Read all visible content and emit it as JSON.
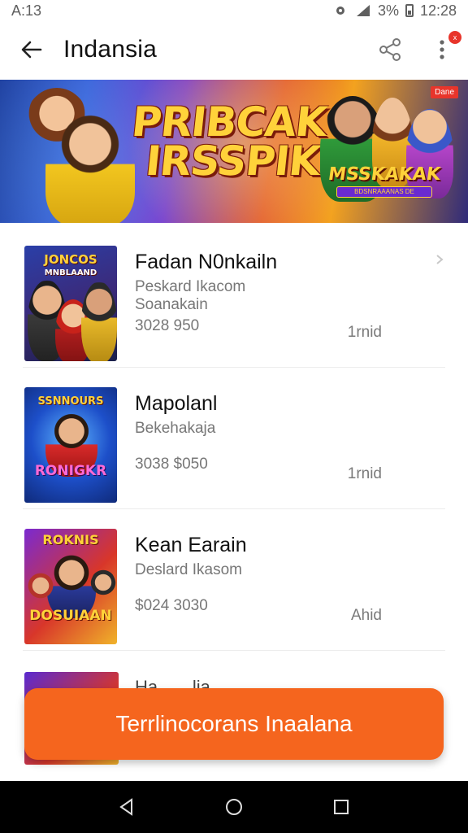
{
  "status_bar": {
    "time_left": "A:13",
    "battery_percent": "3%",
    "clock": "12:28"
  },
  "app_bar": {
    "title": "Indansia",
    "notification_badge": "x"
  },
  "banner": {
    "headline_line1": "PRIBCAK",
    "headline_line2": "IRSSPIK!",
    "logo_title": "MSSKAKAK",
    "logo_sub": "BDSNRAAANAS DE",
    "ad_tag": "Dane"
  },
  "games": [
    {
      "thumb_caption": "JONCOS",
      "thumb_caption2": "MNBLAAND",
      "name": "Fadan N0nkailn",
      "line1": "Peskard Ikacom",
      "line2": "Soanakain",
      "price": "3028 950",
      "meta": "1rnid"
    },
    {
      "thumb_caption": "SSNNOURS",
      "thumb_caption2": "RONIGKR",
      "name": "Mapolanl",
      "line1": "Bekehakaja",
      "line2": "",
      "price": "3038 $050",
      "meta": "1rnid"
    },
    {
      "thumb_caption": "ROKNIS",
      "thumb_caption2": "DOSUIAAN",
      "name": "Kean Earain",
      "line1": "Deslard Ikasom",
      "line2": "",
      "price": "$024 3030",
      "meta": "Ahid"
    }
  ],
  "peek_item": {
    "name": "Ha... ...lia"
  },
  "cta": {
    "label": "Terrlinocorans Inaalana"
  },
  "colors": {
    "accent": "#f5651e",
    "badge": "#e8352b"
  }
}
